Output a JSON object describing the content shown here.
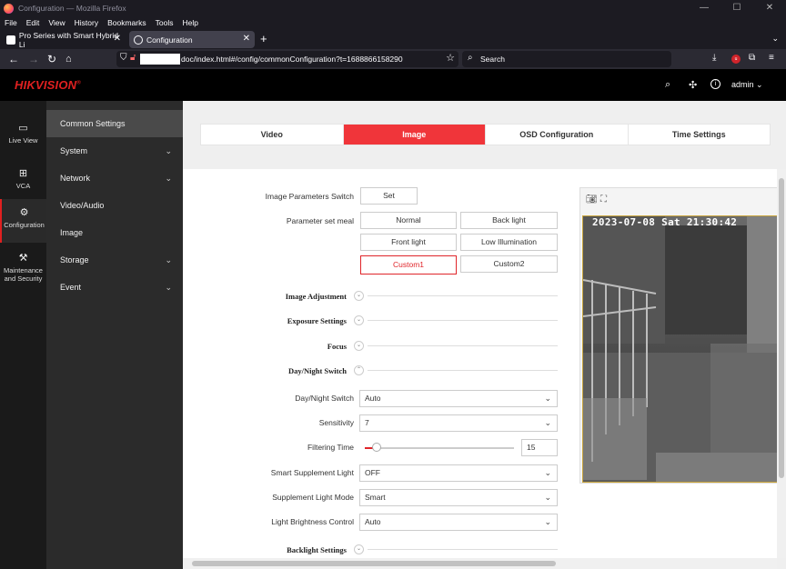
{
  "window": {
    "title": "Configuration — Mozilla Firefox",
    "controls": [
      "—",
      "☐",
      "✕"
    ]
  },
  "menubar": [
    "File",
    "Edit",
    "View",
    "History",
    "Bookmarks",
    "Tools",
    "Help"
  ],
  "tabs": [
    {
      "label": "Pro Series with Smart Hybrid Li",
      "close": "✕"
    },
    {
      "label": "Configuration",
      "close": "✕"
    }
  ],
  "new_tab": "+",
  "tab_list": "⌄",
  "urlbar": {
    "url": "doc/index.html#/config/commonConfiguration?t=1688866158290"
  },
  "search": {
    "placeholder": "Search"
  },
  "app": {
    "logo": "HIKVISION",
    "logo_mark": "®",
    "user": "admin"
  },
  "rail": [
    {
      "label": "Live View",
      "icon": "monitor-icon"
    },
    {
      "label": "VCA",
      "icon": "grid-icon"
    },
    {
      "label": "Configuration",
      "icon": "gear-icon"
    },
    {
      "label": "Maintenance and Security",
      "icon": "tools-icon"
    }
  ],
  "submenu": [
    {
      "label": "Common Settings",
      "chevron": ""
    },
    {
      "label": "System",
      "chevron": "⌄"
    },
    {
      "label": "Network",
      "chevron": "⌄"
    },
    {
      "label": "Video/Audio",
      "chevron": ""
    },
    {
      "label": "Image",
      "chevron": ""
    },
    {
      "label": "Storage",
      "chevron": "⌄"
    },
    {
      "label": "Event",
      "chevron": "⌄"
    }
  ],
  "content_tabs": [
    "Video",
    "Image",
    "OSD Configuration",
    "Time Settings"
  ],
  "active_content_tab": "Image",
  "form": {
    "image_params_switch_label": "Image Parameters Switch",
    "set_button": "Set",
    "param_set_meal_label": "Parameter set meal",
    "meals": [
      "Normal",
      "Back light",
      "Front light",
      "Low Illumination",
      "Custom1",
      "Custom2"
    ],
    "selected_meal": "Custom1",
    "sections": {
      "image_adjustment": "Image Adjustment",
      "exposure_settings": "Exposure Settings",
      "focus": "Focus",
      "day_night_switch": "Day/Night Switch",
      "backlight_settings": "Backlight Settings"
    },
    "day_night_switch_label": "Day/Night Switch",
    "day_night_switch_value": "Auto",
    "sensitivity_label": "Sensitivity",
    "sensitivity_value": "7",
    "filtering_time_label": "Filtering Time",
    "filtering_time_value": "15",
    "filtering_time_fraction": 0.08,
    "smart_supplement_light_label": "Smart Supplement Light",
    "smart_supplement_light_value": "OFF",
    "supplement_light_mode_label": "Supplement Light Mode",
    "supplement_light_mode_value": "Smart",
    "light_brightness_control_label": "Light Brightness Control",
    "light_brightness_control_value": "Auto"
  },
  "preview": {
    "osd_text": "2023-07-08 Sat 21:30:42"
  },
  "colors": {
    "accent": "#f0353a",
    "brand": "#e02020",
    "chrome": "#1c1b22"
  }
}
